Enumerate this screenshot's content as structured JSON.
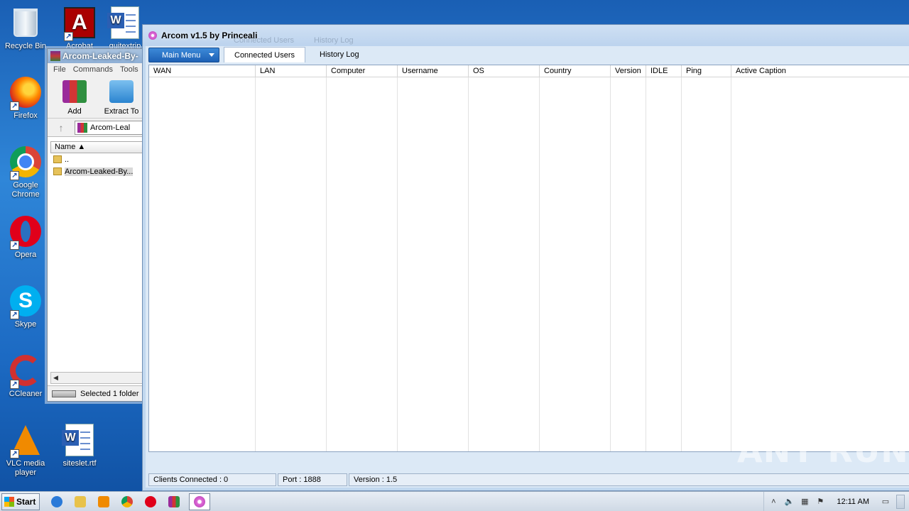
{
  "desktop": {
    "icons": [
      {
        "label": "Recycle Bin"
      },
      {
        "label": "Acrobat"
      },
      {
        "label": "quitextrip"
      },
      {
        "label": "Firefox"
      },
      {
        "label": "Google Chrome"
      },
      {
        "label": "Opera"
      },
      {
        "label": "Skype"
      },
      {
        "label": "CCleaner"
      },
      {
        "label": "VLC media player"
      },
      {
        "label": "siteslet.rtf"
      }
    ]
  },
  "winrar": {
    "title": "Arcom-Leaked-By-",
    "menu": [
      "File",
      "Commands",
      "Tools"
    ],
    "tools": [
      {
        "label": "Add"
      },
      {
        "label": "Extract To"
      }
    ],
    "address": "Arcom-Leal",
    "column_name": "Name",
    "rows": [
      "..",
      "Arcom-Leaked-By..."
    ],
    "status": "Selected 1 folder"
  },
  "arcom": {
    "title": "Arcom v1.5 by Princeali",
    "ghost_tabs": [
      "Connected Users",
      "History Log"
    ],
    "main_menu": "Main Menu",
    "tabs": [
      "Connected Users",
      "History Log"
    ],
    "columns": [
      "WAN",
      "LAN",
      "Computer",
      "Username",
      "OS",
      "Country",
      "Version",
      "IDLE",
      "Ping",
      "Active Caption"
    ],
    "status": {
      "clients": "Clients Connected : 0",
      "port": "Port : 1888",
      "version": "Version : 1.5"
    }
  },
  "watermark": "ANY RUN",
  "taskbar": {
    "start_label": "Start",
    "clock": "12:11 AM"
  }
}
